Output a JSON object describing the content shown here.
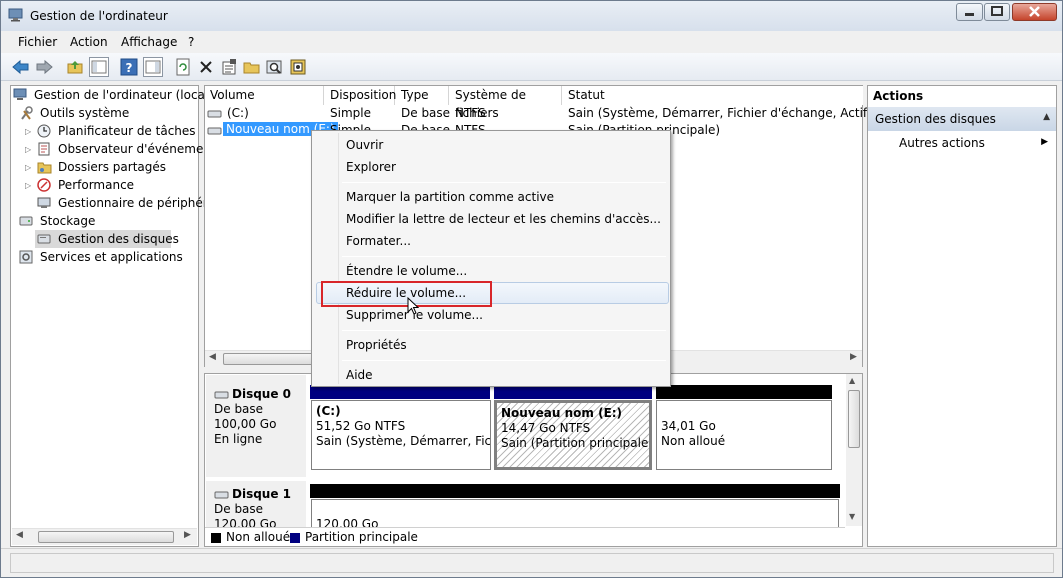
{
  "window": {
    "title": "Gestion de l'ordinateur"
  },
  "menu": [
    "Fichier",
    "Action",
    "Affichage",
    "?"
  ],
  "tree": {
    "root": "Gestion de l'ordinateur (local)",
    "system_tools": "Outils système",
    "task_scheduler": "Planificateur de tâches",
    "event_viewer": "Observateur d'événements",
    "shared_folders": "Dossiers partagés",
    "performance": "Performance",
    "device_manager": "Gestionnaire de périphériq",
    "storage": "Stockage",
    "disk_management": "Gestion des disques",
    "services": "Services et applications"
  },
  "volumes": {
    "headers": [
      "Volume",
      "Disposition",
      "Type",
      "Système de fichiers",
      "Statut"
    ],
    "rows": [
      {
        "volume": "(C:)",
        "layout": "Simple",
        "type": "De base",
        "fs": "NTFS",
        "status": "Sain (Système, Démarrer, Fichier d'échange, Actif, Vidag"
      },
      {
        "volume": "Nouveau nom  (E:)",
        "layout": "Simple",
        "type": "De base",
        "fs": "NTFS",
        "status": "Sain (Partition principale)"
      }
    ]
  },
  "disks": [
    {
      "name": "Disque 0",
      "type": "De base",
      "size": "100,00 Go",
      "state": "En ligne"
    },
    {
      "name": "Disque 1",
      "type": "De base",
      "size": "120,00 Go",
      "state": ""
    }
  ],
  "partitions": {
    "c": {
      "name": "(C:)",
      "size": "51,52 Go NTFS",
      "status": "Sain (Système, Démarrer, Fichier"
    },
    "e": {
      "name": "Nouveau nom  (E:)",
      "size": "14,47 Go NTFS",
      "status": "Sain (Partition principale)"
    },
    "unalloc": {
      "size": "34,01 Go",
      "status": "Non alloué"
    },
    "disk1": {
      "size": "120,00 Go"
    }
  },
  "legend": {
    "unallocated": "Non alloué",
    "primary": "Partition principale"
  },
  "context_menu": {
    "open": "Ouvrir",
    "explore": "Explorer",
    "mark_active": "Marquer la partition comme active",
    "change_letter": "Modifier la lettre de lecteur et les chemins d'accès...",
    "format": "Formater...",
    "extend": "Étendre le volume...",
    "shrink": "Réduire le volume...",
    "delete": "Supprimer le volume...",
    "properties": "Propriétés",
    "help": "Aide"
  },
  "actions": {
    "title": "Actions",
    "section": "Gestion des disques",
    "more": "Autres actions"
  },
  "colors": {
    "primary": "#000080",
    "unallocated": "#000000",
    "highlight": "#d8262a",
    "selection": "#3399ff"
  }
}
